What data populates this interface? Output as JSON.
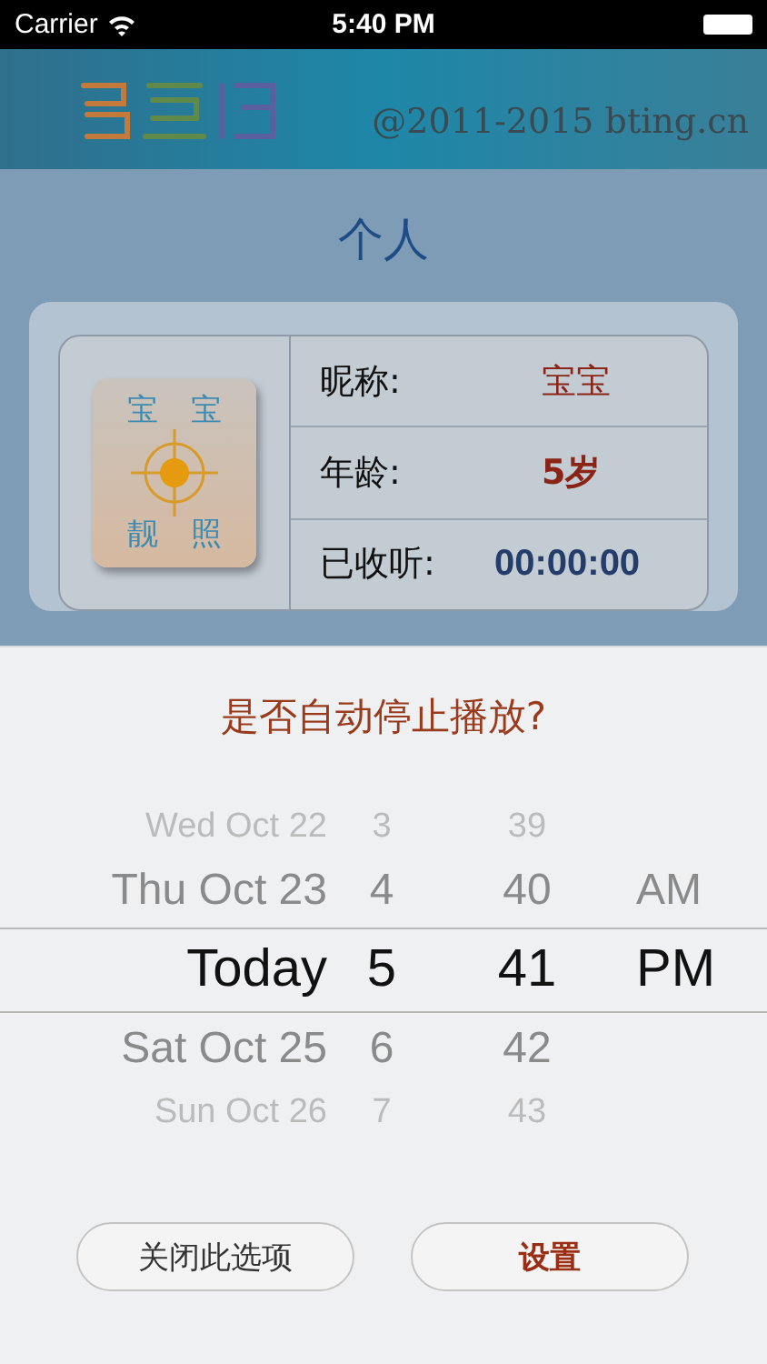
{
  "status_bar": {
    "carrier": "Carrier",
    "time": "5:40 PM"
  },
  "banner": {
    "copyright": "@2011-2015 bting.cn"
  },
  "page_title": "个人",
  "profile": {
    "photo_labels": [
      "宝",
      "宝",
      "靓",
      "照"
    ],
    "fields": [
      {
        "label": "昵称:",
        "value": "宝宝",
        "kind": "name"
      },
      {
        "label": "年龄:",
        "value": "5岁",
        "kind": "age"
      },
      {
        "label": "已收听:",
        "value": "00:00:00",
        "kind": "time"
      }
    ]
  },
  "sheet": {
    "title": "是否自动停止播放?",
    "picker": {
      "rows": [
        {
          "day": "Wed Oct 22",
          "hour": "3",
          "minute": "39",
          "selected": false
        },
        {
          "day": "Thu Oct 23",
          "hour": "4",
          "minute": "40",
          "period": "AM",
          "selected": false
        },
        {
          "day": "Today",
          "hour": "5",
          "minute": "41",
          "period": "PM",
          "selected": true
        },
        {
          "day": "Sat Oct 25",
          "hour": "6",
          "minute": "42",
          "selected": false
        },
        {
          "day": "Sun Oct 26",
          "hour": "7",
          "minute": "43",
          "selected": false
        }
      ]
    },
    "buttons": [
      {
        "label": "关闭此选项",
        "kind": "cancel"
      },
      {
        "label": "设置",
        "kind": "confirm"
      }
    ]
  }
}
